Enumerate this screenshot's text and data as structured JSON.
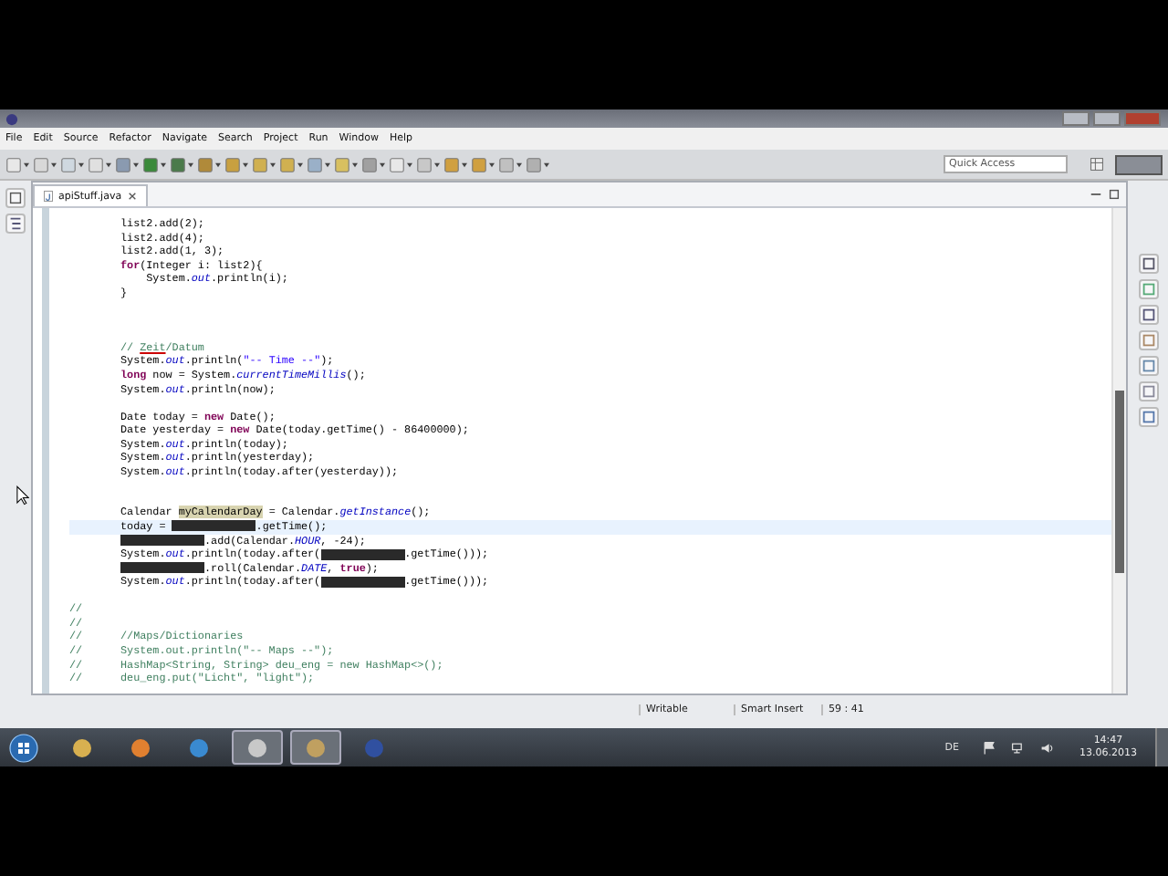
{
  "menu": [
    "File",
    "Edit",
    "Source",
    "Refactor",
    "Navigate",
    "Search",
    "Project",
    "Run",
    "Window",
    "Help"
  ],
  "quick_access": {
    "placeholder": "Quick Access"
  },
  "tabs": [
    {
      "label": "apiStuff.java",
      "selected": true
    }
  ],
  "code": [
    {
      "kind": "code",
      "segments": [
        {
          "kind": "plain",
          "text": "list2.add(2);"
        }
      ]
    },
    {
      "kind": "code",
      "segments": [
        {
          "kind": "plain",
          "text": "list2.add(4);"
        }
      ]
    },
    {
      "kind": "code",
      "segments": [
        {
          "kind": "plain",
          "text": "list2.add(1, 3);"
        }
      ]
    },
    {
      "kind": "code",
      "segments": [
        {
          "kind": "keyword",
          "text": "for"
        },
        {
          "kind": "plain",
          "text": "(Integer i: list2){"
        }
      ]
    },
    {
      "kind": "code",
      "segments": [
        {
          "kind": "plain",
          "text": "    System."
        },
        {
          "kind": "static",
          "text": "out"
        },
        {
          "kind": "plain",
          "text": ".println(i);"
        }
      ]
    },
    {
      "kind": "code",
      "segments": [
        {
          "kind": "plain",
          "text": "}"
        }
      ]
    },
    {
      "kind": "blank"
    },
    {
      "kind": "blank"
    },
    {
      "kind": "blank"
    },
    {
      "kind": "code",
      "segments": [
        {
          "kind": "comment",
          "text": "// "
        },
        {
          "kind": "misspelled",
          "text": "Zeit"
        },
        {
          "kind": "comment",
          "text": "/Datum"
        }
      ]
    },
    {
      "kind": "code",
      "segments": [
        {
          "kind": "plain",
          "text": "System."
        },
        {
          "kind": "static",
          "text": "out"
        },
        {
          "kind": "plain",
          "text": ".println("
        },
        {
          "kind": "string",
          "text": "\"-- Time --\""
        },
        {
          "kind": "plain",
          "text": ");"
        }
      ]
    },
    {
      "kind": "code",
      "segments": [
        {
          "kind": "keyword",
          "text": "long"
        },
        {
          "kind": "plain",
          "text": " now = System."
        },
        {
          "kind": "static",
          "text": "currentTimeMillis"
        },
        {
          "kind": "plain",
          "text": "();"
        }
      ]
    },
    {
      "kind": "code",
      "segments": [
        {
          "kind": "plain",
          "text": "System."
        },
        {
          "kind": "static",
          "text": "out"
        },
        {
          "kind": "plain",
          "text": ".println(now);"
        }
      ]
    },
    {
      "kind": "blank"
    },
    {
      "kind": "code",
      "segments": [
        {
          "kind": "plain",
          "text": "Date today = "
        },
        {
          "kind": "keyword",
          "text": "new"
        },
        {
          "kind": "plain",
          "text": " Date();"
        }
      ]
    },
    {
      "kind": "code",
      "segments": [
        {
          "kind": "plain",
          "text": "Date yesterday = "
        },
        {
          "kind": "keyword",
          "text": "new"
        },
        {
          "kind": "plain",
          "text": " Date(today.getTime() - 86400000);"
        }
      ]
    },
    {
      "kind": "code",
      "segments": [
        {
          "kind": "plain",
          "text": "System."
        },
        {
          "kind": "static",
          "text": "out"
        },
        {
          "kind": "plain",
          "text": ".println(today);"
        }
      ]
    },
    {
      "kind": "code",
      "segments": [
        {
          "kind": "plain",
          "text": "System."
        },
        {
          "kind": "static",
          "text": "out"
        },
        {
          "kind": "plain",
          "text": ".println(yesterday);"
        }
      ]
    },
    {
      "kind": "code",
      "segments": [
        {
          "kind": "plain",
          "text": "System."
        },
        {
          "kind": "static",
          "text": "out"
        },
        {
          "kind": "plain",
          "text": ".println(today.after(yesterday));"
        }
      ]
    },
    {
      "kind": "blank"
    },
    {
      "kind": "blank"
    },
    {
      "kind": "code",
      "segments": [
        {
          "kind": "plain",
          "text": "Calendar "
        },
        {
          "kind": "occurrence",
          "text": "myCalendarDay"
        },
        {
          "kind": "plain",
          "text": " = Calendar."
        },
        {
          "kind": "static",
          "text": "getInstance"
        },
        {
          "kind": "plain",
          "text": "();"
        }
      ]
    },
    {
      "kind": "code",
      "current": true,
      "segments": [
        {
          "kind": "plain",
          "text": "today = "
        },
        {
          "kind": "redacted"
        },
        {
          "kind": "plain",
          "text": ".getTime();"
        }
      ]
    },
    {
      "kind": "code",
      "segments": [
        {
          "kind": "redacted"
        },
        {
          "kind": "plain",
          "text": ".add(Calendar."
        },
        {
          "kind": "static",
          "text": "HOUR"
        },
        {
          "kind": "plain",
          "text": ", -24);"
        }
      ]
    },
    {
      "kind": "code",
      "segments": [
        {
          "kind": "plain",
          "text": "System."
        },
        {
          "kind": "static",
          "text": "out"
        },
        {
          "kind": "plain",
          "text": ".println(today.after("
        },
        {
          "kind": "redacted"
        },
        {
          "kind": "plain",
          "text": ".getTime()));"
        }
      ]
    },
    {
      "kind": "code",
      "segments": [
        {
          "kind": "redacted"
        },
        {
          "kind": "plain",
          "text": ".roll(Calendar."
        },
        {
          "kind": "static",
          "text": "DATE"
        },
        {
          "kind": "plain",
          "text": ", "
        },
        {
          "kind": "keyword",
          "text": "true"
        },
        {
          "kind": "plain",
          "text": ");"
        }
      ]
    },
    {
      "kind": "code",
      "segments": [
        {
          "kind": "plain",
          "text": "System."
        },
        {
          "kind": "static",
          "text": "out"
        },
        {
          "kind": "plain",
          "text": ".println(today.after("
        },
        {
          "kind": "redacted"
        },
        {
          "kind": "plain",
          "text": ".getTime()));"
        }
      ]
    },
    {
      "kind": "blank"
    },
    {
      "kind": "commented",
      "prefix": "//"
    },
    {
      "kind": "commented",
      "prefix": "//"
    },
    {
      "kind": "commented",
      "prefix": "//",
      "segments": [
        {
          "kind": "comment",
          "text": "//Maps/Dictionaries"
        }
      ]
    },
    {
      "kind": "commented",
      "prefix": "//",
      "segments": [
        {
          "kind": "comment",
          "text": "System.out.println(\"-- Maps --\");"
        }
      ]
    },
    {
      "kind": "commented",
      "prefix": "//",
      "segments": [
        {
          "kind": "comment",
          "text": "HashMap<String, String> deu_eng = new HashMap<>();"
        }
      ]
    },
    {
      "kind": "commented",
      "prefix": "//",
      "segments": [
        {
          "kind": "comment",
          "text": "deu_eng.put(\"Licht\", \"light\");"
        }
      ]
    }
  ],
  "status_bar": [
    "Writable",
    "Smart Insert",
    "59 : 41"
  ],
  "taskbar": [
    {
      "kind": "explorer",
      "active": false
    },
    {
      "kind": "media",
      "active": false
    },
    {
      "kind": "browser",
      "active": false
    },
    {
      "kind": "window",
      "active": true
    },
    {
      "kind": "eclipse",
      "active": true
    },
    {
      "kind": "sphere",
      "active": false
    }
  ],
  "tray": {
    "language": "DE",
    "time": "14:47",
    "date": "13.06.2013"
  }
}
